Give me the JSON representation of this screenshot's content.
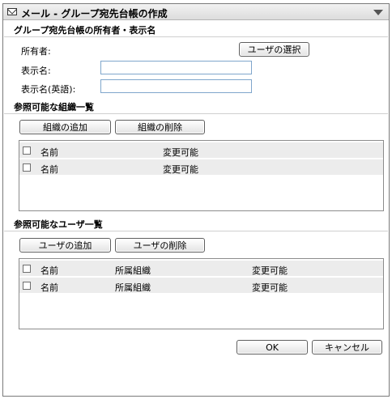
{
  "window": {
    "title": "メール - グループ宛先台帳の作成"
  },
  "owner_section": {
    "heading": "グループ宛先台帳の所有者・表示名",
    "owner_label": "所有者:",
    "select_user_button": "ユーザの選択",
    "display_name_label": "表示名:",
    "display_name_value": "",
    "display_name_en_label": "表示名(英語):",
    "display_name_en_value": ""
  },
  "org_section": {
    "heading": "参照可能な組織一覧",
    "add_button": "組織の追加",
    "remove_button": "組織の削除",
    "rows": [
      {
        "name": "名前",
        "editable": "変更可能"
      },
      {
        "name": "名前",
        "editable": "変更可能"
      }
    ]
  },
  "user_section": {
    "heading": "参照可能なユーザ一覧",
    "add_button": "ユーザの追加",
    "remove_button": "ユーザの削除",
    "rows": [
      {
        "name": "名前",
        "org": "所属組織",
        "editable": "変更可能"
      },
      {
        "name": "名前",
        "org": "所属組織",
        "editable": "変更可能"
      }
    ]
  },
  "footer": {
    "ok_button": "OK",
    "cancel_button": "キャンセル"
  }
}
